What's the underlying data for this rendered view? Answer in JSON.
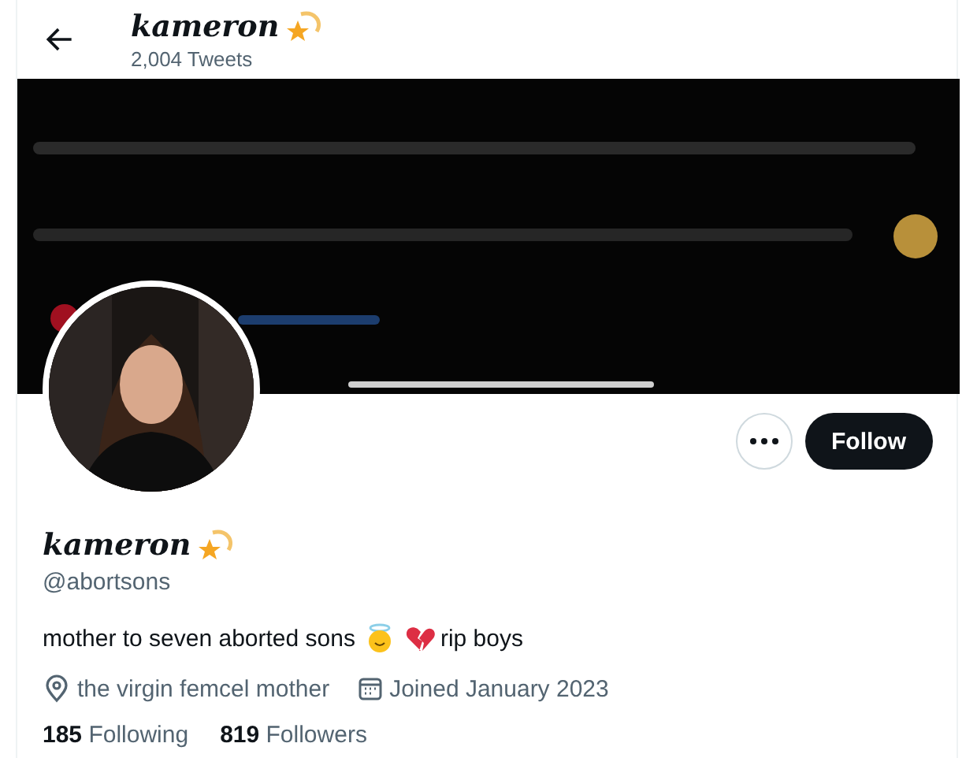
{
  "header": {
    "name": "kameron",
    "tweet_count": "2,004 Tweets"
  },
  "actions": {
    "follow": "Follow"
  },
  "profile": {
    "name": "kameron",
    "handle": "@abortsons",
    "bio": [
      {
        "kind": "text",
        "text": "mother to seven aborted sons"
      },
      {
        "kind": "angel"
      },
      {
        "kind": "broken-heart"
      },
      {
        "kind": "text",
        "text": "rip boys"
      }
    ],
    "location": "the virgin femcel mother",
    "joined": "Joined January 2023"
  },
  "stats": [
    {
      "text": "**185** Following"
    },
    {
      "text": "**819** Followers"
    }
  ]
}
